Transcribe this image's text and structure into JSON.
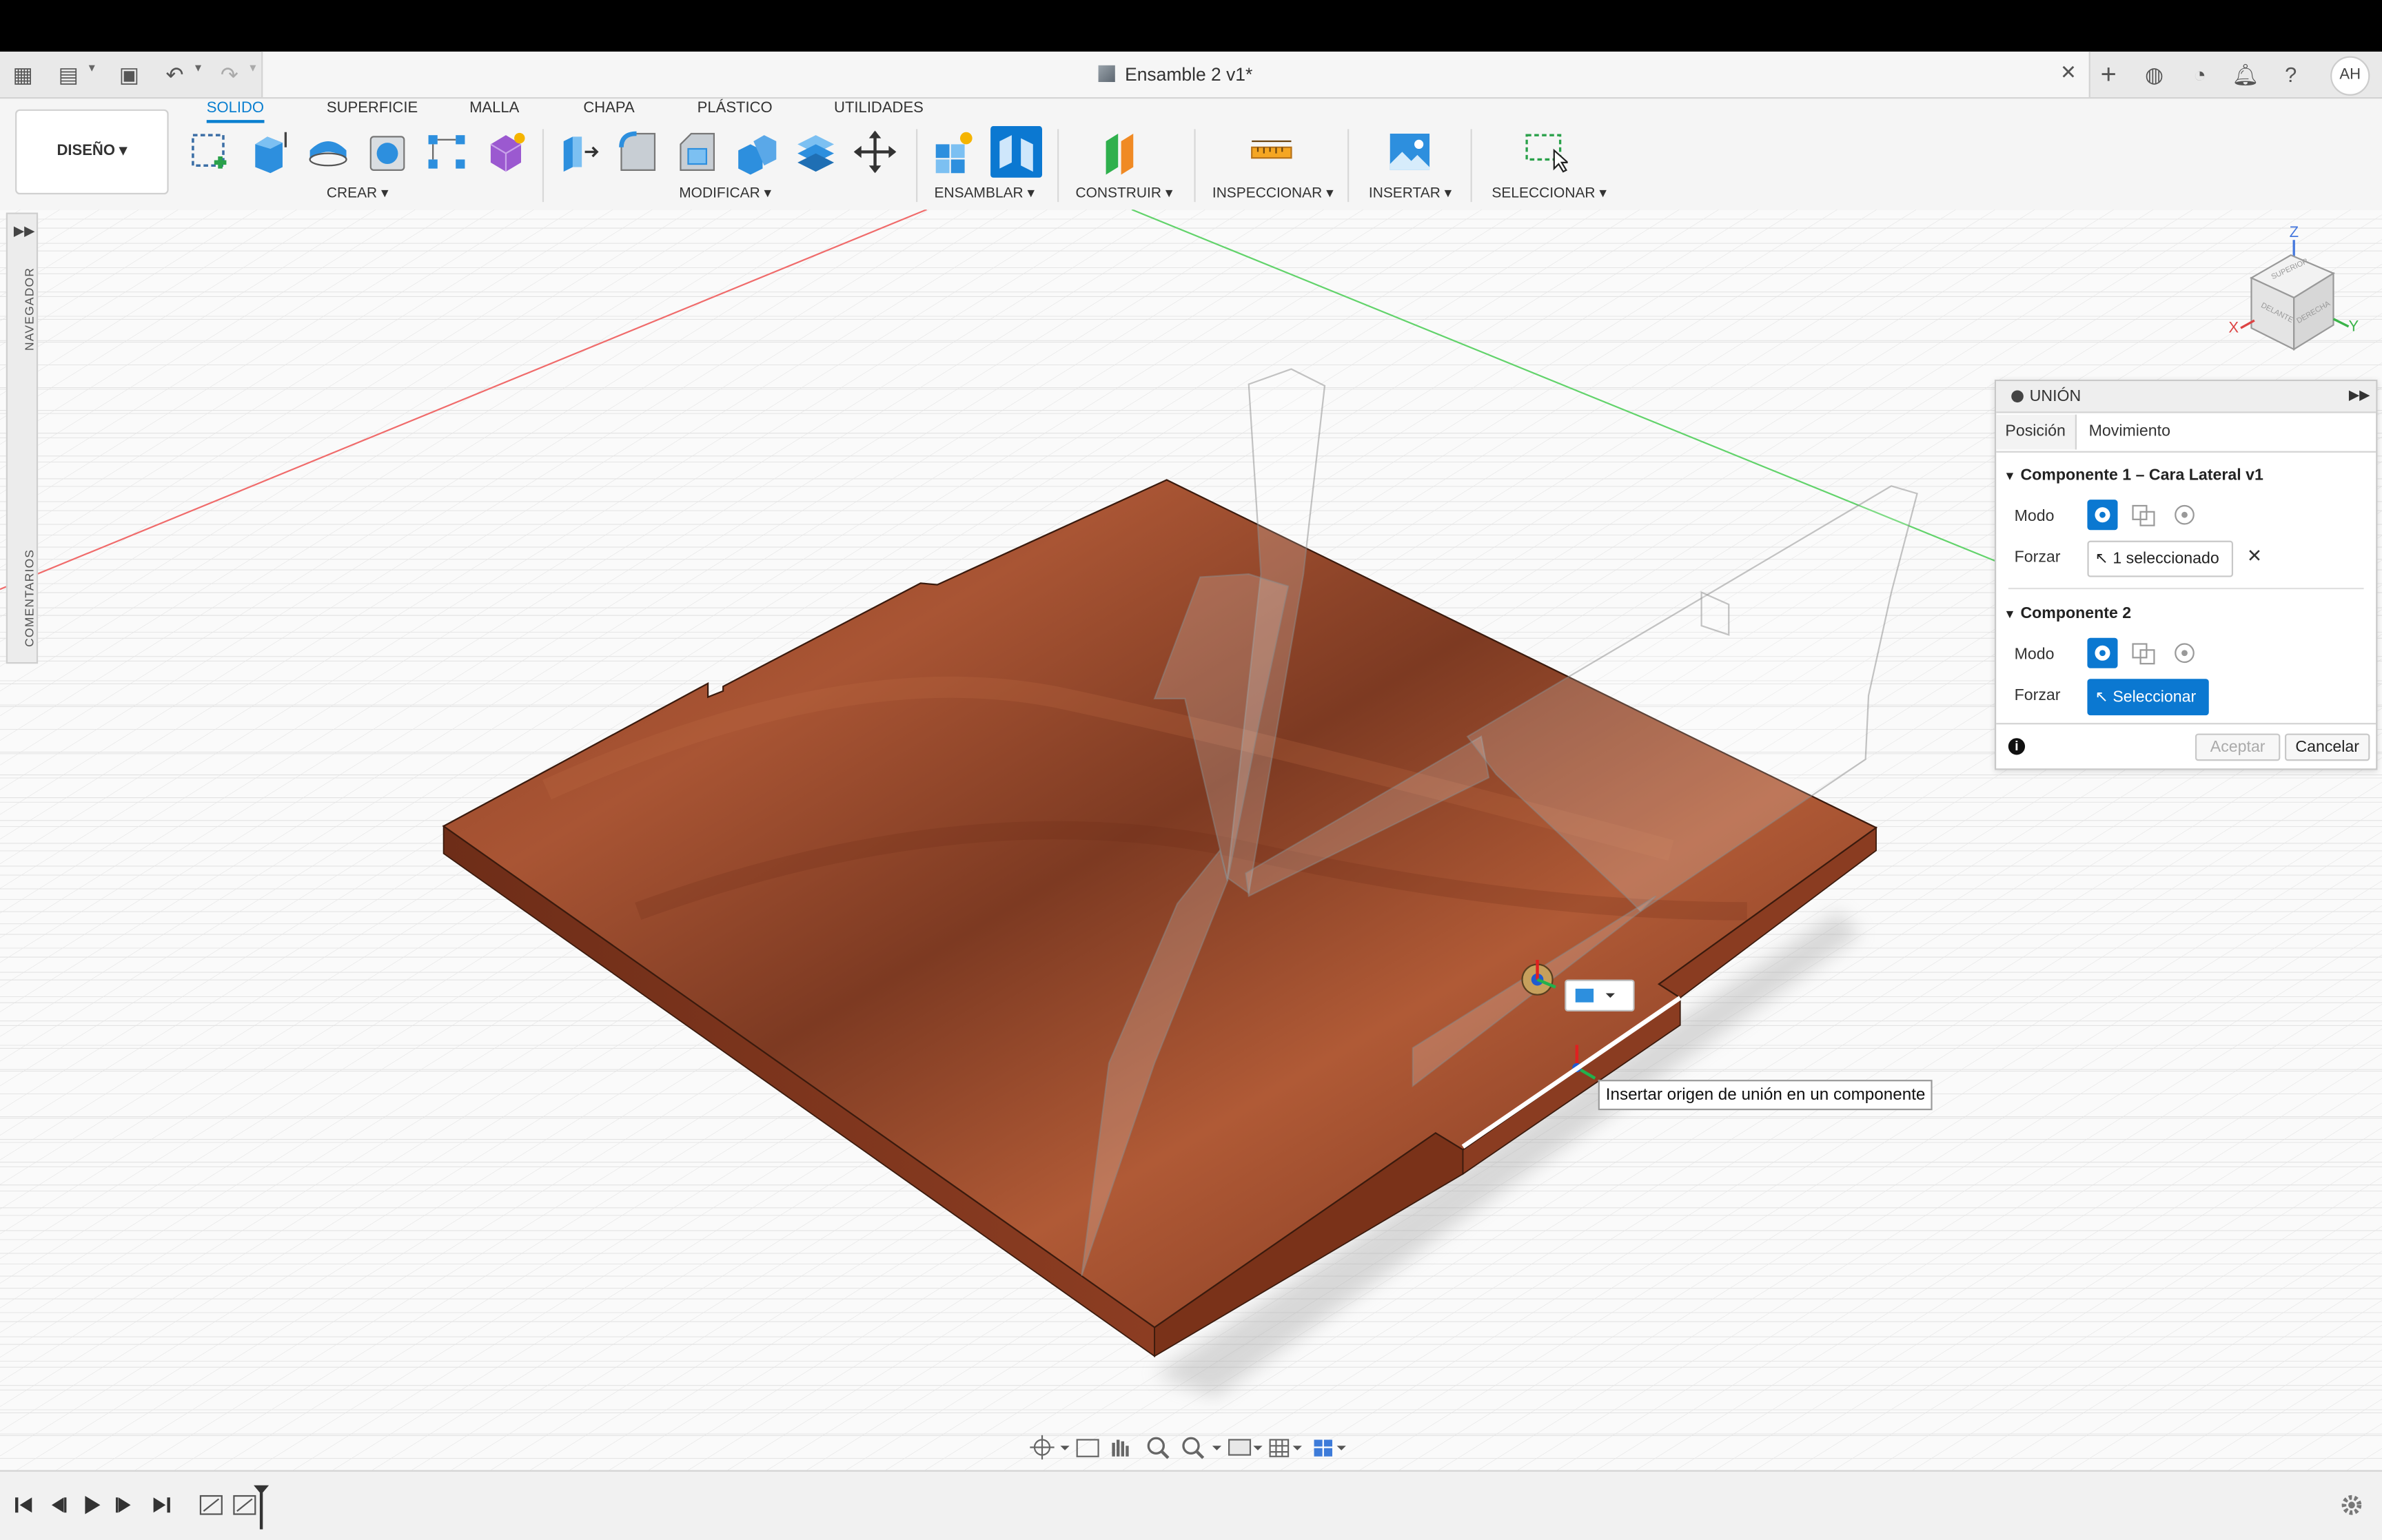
{
  "window": {
    "document_title": "Ensamble 2 v1*",
    "avatar_initials": "AH",
    "icons": [
      "apps-grid-icon",
      "file-icon",
      "save-icon",
      "undo-icon",
      "redo-icon",
      "close-icon",
      "new-tab-icon",
      "extensions-icon",
      "job-status-icon",
      "notifications-icon",
      "help-icon"
    ]
  },
  "toolbar": {
    "design_button": "DISEÑO",
    "tabs": [
      {
        "label": "SOLIDO",
        "active": true
      },
      {
        "label": "SUPERFICIE",
        "active": false
      },
      {
        "label": "MALLA",
        "active": false
      },
      {
        "label": "CHAPA",
        "active": false
      },
      {
        "label": "PLÁSTICO",
        "active": false
      },
      {
        "label": "UTILIDADES",
        "active": false
      }
    ],
    "groups": {
      "crear": "CREAR",
      "modificar": "MODIFICAR",
      "ensamblar": "ENSAMBLAR",
      "construir": "CONSTRUIR",
      "inspeccionar": "INSPECCIONAR",
      "insertar": "INSERTAR",
      "seleccionar": "SELECCIONAR"
    }
  },
  "left_panel": {
    "navigator_label": "NAVEGADOR",
    "comments_label": "COMENTARIOS"
  },
  "union_dialog": {
    "title": "UNIÓN",
    "tabs": [
      "Posición",
      "Movimiento"
    ],
    "component1": {
      "header": "Componente 1 – Cara Lateral v1",
      "mode_label": "Modo",
      "force_label": "Forzar",
      "force_value": "1 seleccionado"
    },
    "component2": {
      "header": "Componente 2",
      "mode_label": "Modo",
      "force_label": "Forzar",
      "force_value": "Seleccionar"
    },
    "accept_button": "Aceptar",
    "cancel_button": "Cancelar"
  },
  "viewcube": {
    "axis_z": "Z",
    "axis_x": "X",
    "axis_y": "Y",
    "face_top": "SUPERIOR",
    "face_front": "DELANTE",
    "face_right": "DERECHA"
  },
  "tooltip": "Insertar origen de unión en un componente",
  "colors": {
    "accent": "#0b78d1",
    "wood": "#9a4a2a",
    "grid": "#e2e2e2"
  }
}
